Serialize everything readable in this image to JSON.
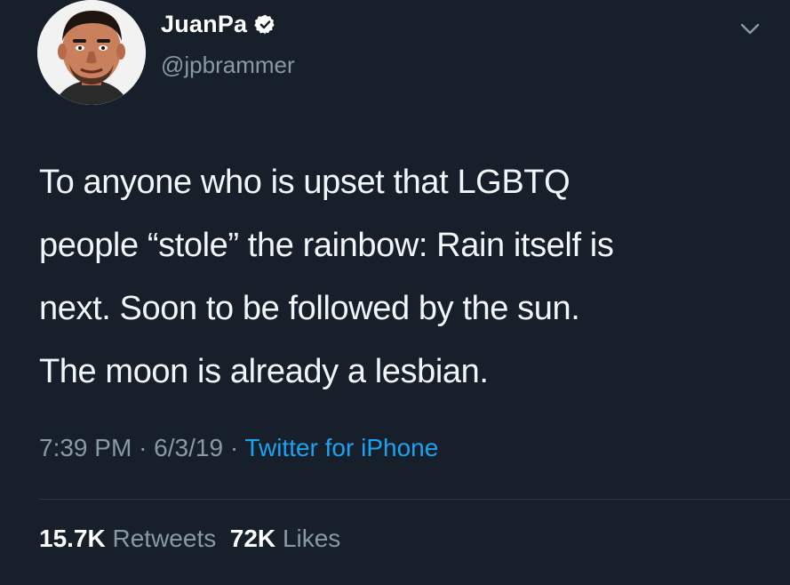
{
  "user": {
    "display_name": "JuanPa",
    "handle": "@jpbrammer",
    "verified": true
  },
  "tweet": {
    "lines": [
      "To anyone who is upset that LGBTQ",
      "people “stole” the rainbow: Rain itself is",
      "next. Soon to be followed by the sun.",
      "The moon is already a lesbian."
    ],
    "time": "7:39 PM",
    "date": "6/3/19",
    "separator": "·",
    "source": "Twitter for iPhone"
  },
  "stats": {
    "retweets_count": "15.7K",
    "retweets_label": "Retweets",
    "likes_count": "72K",
    "likes_label": "Likes"
  },
  "icons": {
    "verified": "verified-badge-icon",
    "menu": "chevron-down-icon"
  },
  "colors": {
    "background": "#161f2a",
    "text": "#f3f6f8",
    "secondary": "#8899a6",
    "link": "#1da1f2"
  }
}
